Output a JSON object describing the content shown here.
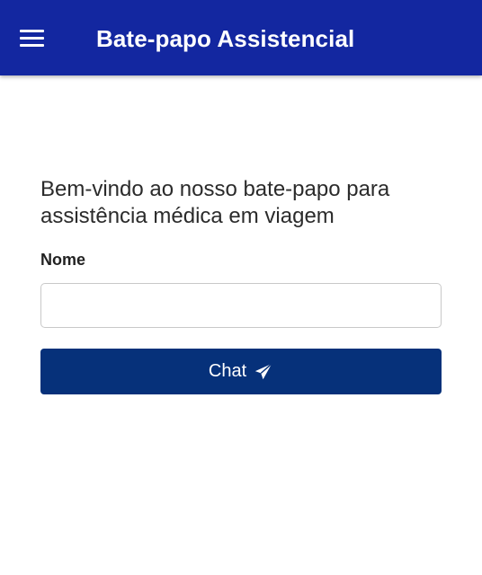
{
  "header": {
    "title": "Bate-papo Assistencial",
    "menu_icon": "hamburger-menu-icon"
  },
  "main": {
    "welcome_text": "Bem-vindo ao nosso bate-papo para assistência médica em viagem",
    "name_label": "Nome",
    "name_value": "",
    "chat_button_label": "Chat",
    "chat_button_icon": "send-paper-plane-icon"
  },
  "colors": {
    "app_bar": "#1327a0",
    "primary_button": "#06317a",
    "text": "#2b2b2b"
  }
}
